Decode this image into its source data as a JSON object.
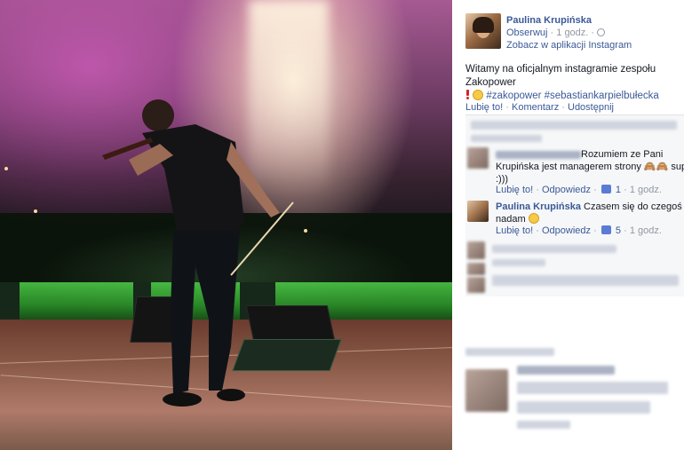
{
  "post": {
    "author": "Paulina Krupińska",
    "follow": "Obserwuj",
    "time": "1 godz.",
    "app_link": "Zobacz w aplikacji Instagram",
    "text": "Witamy na oficjalnym instagramie zespołu Zakopower",
    "hashtags": "#zakopower #sebastiankarpielbułecka",
    "actions": {
      "like": "Lubię to!",
      "comment": "Komentarz",
      "share": "Udostępnij"
    }
  },
  "comments": [
    {
      "author": "",
      "text": "Rozumiem ze Pani Krupińska jest managerem strony 🙈🙈 super !! :)))",
      "text_line1": "Rozumiem ze Pani",
      "text_line2": "Krupińska jest managerem strony 🙈🙈 super !!",
      "text_line3": ":)))",
      "like": "Lubię to!",
      "reply": "Odpowiedz",
      "likes": "1",
      "time": "1 godz."
    },
    {
      "author": "Paulina Krupińska",
      "text_line1": "Czasem się do czegoś",
      "text_line2": "nadam",
      "like": "Lubię to!",
      "reply": "Odpowiedz",
      "likes": "5",
      "time": "1 godz."
    }
  ],
  "colors": {
    "link": "#3b5998",
    "muted": "#9197a3",
    "comment_bg": "#f6f7f8"
  }
}
